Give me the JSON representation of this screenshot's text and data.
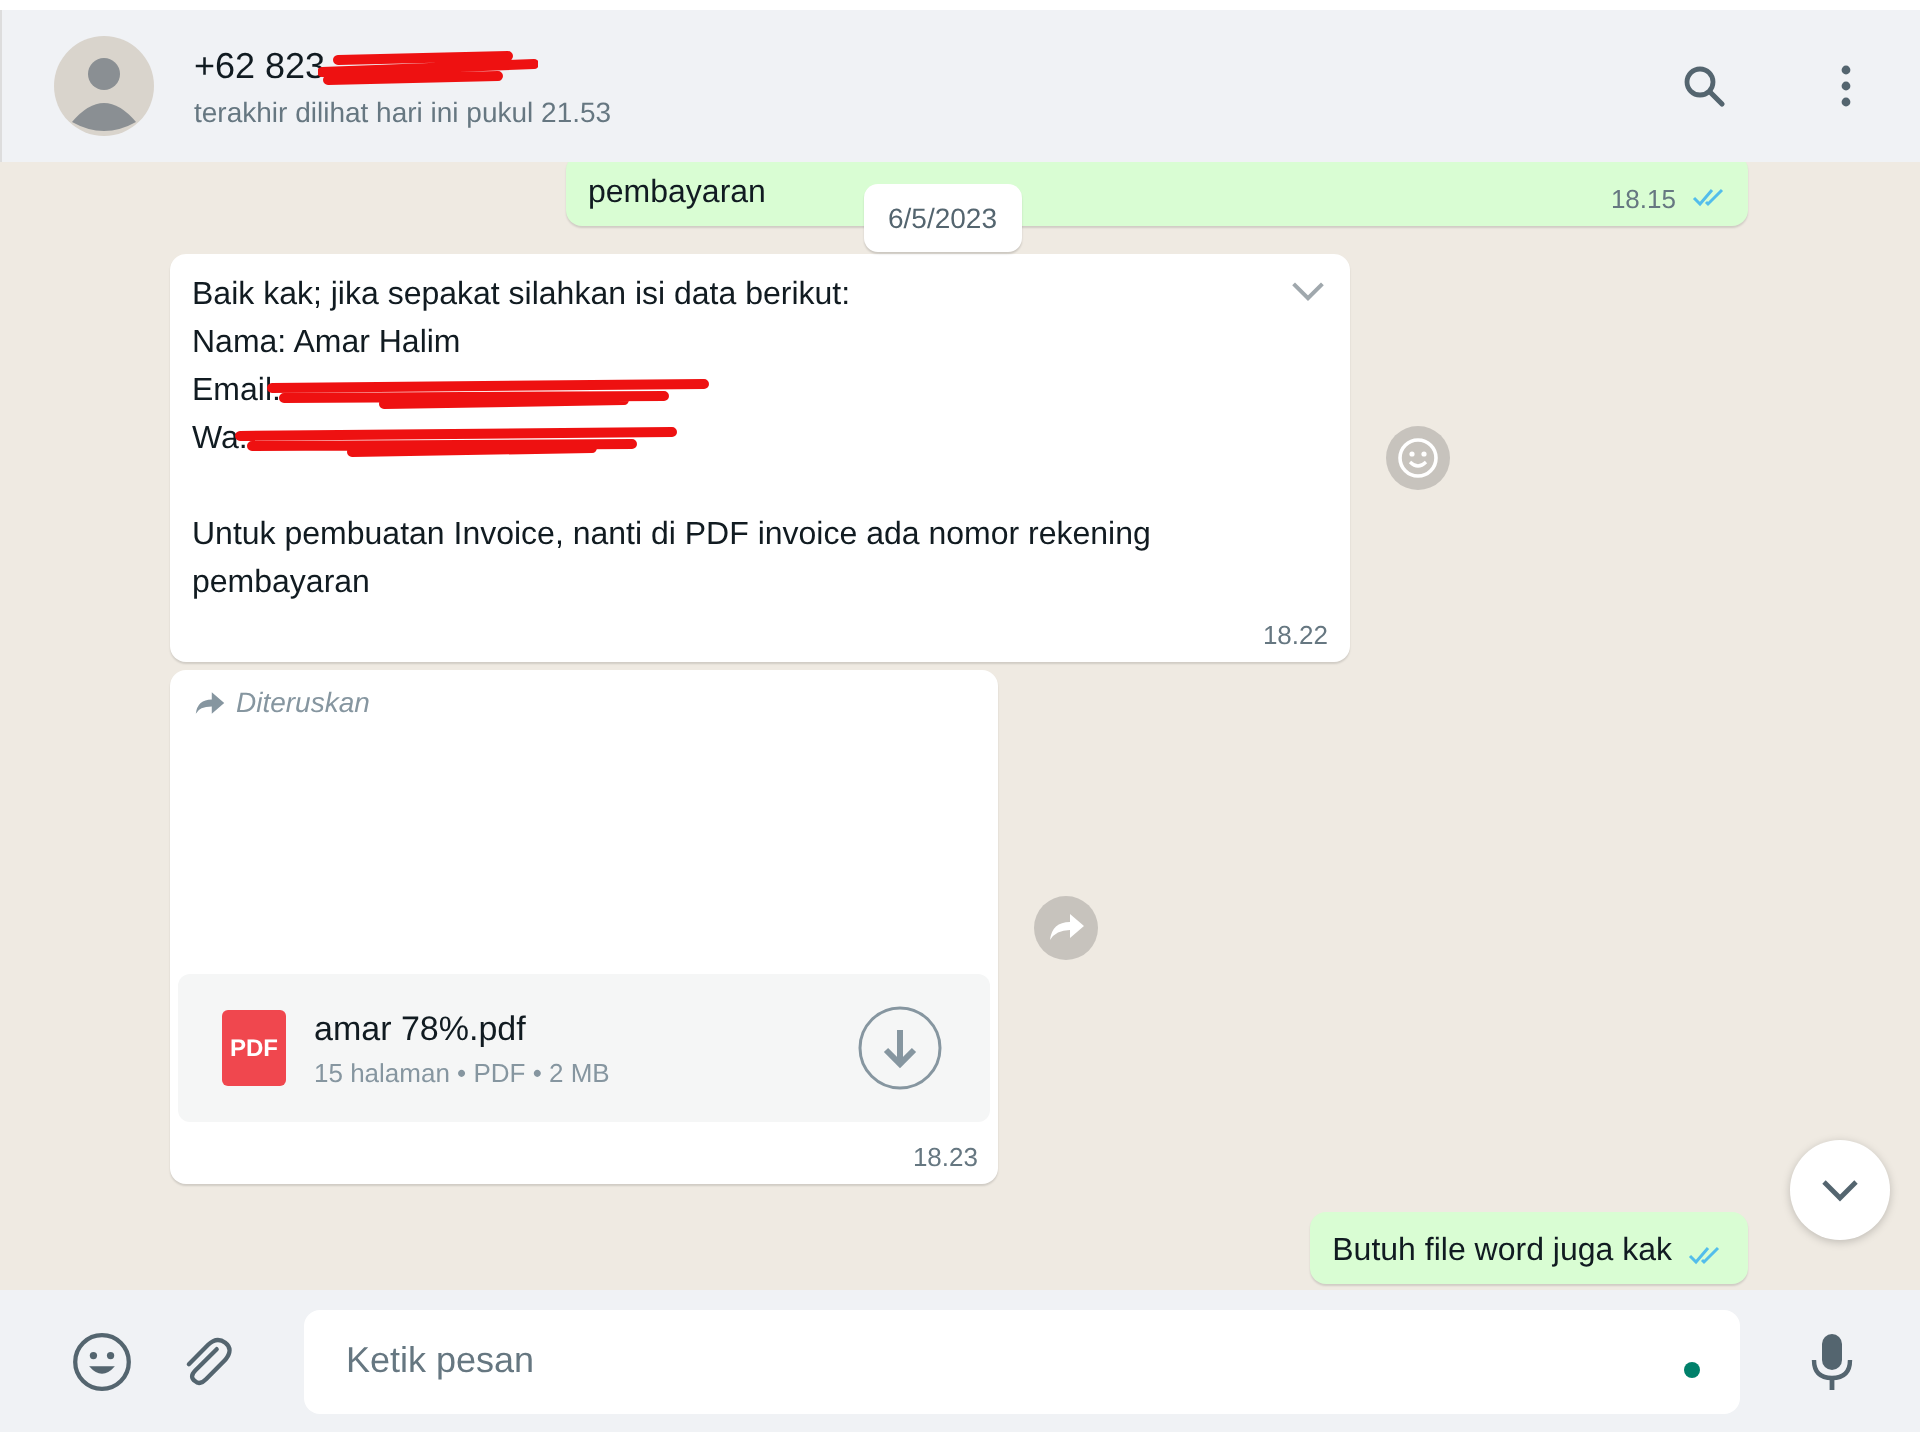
{
  "header": {
    "name": "+62 823",
    "name_redacted": true,
    "status": "terakhir dilihat hari ini pukul 21.53"
  },
  "date_chip": "6/5/2023",
  "messages": [
    {
      "kind": "outgoing",
      "text": "pembayaran",
      "time": "18.15",
      "read": true
    },
    {
      "kind": "text",
      "paragraphs": [
        [
          {
            "text": "Baik kak; jika sepakat silahkan isi data berikut:",
            "redacted": false
          },
          {
            "text": "Nama: Amar Halim",
            "redacted": false
          },
          {
            "text": "Email:",
            "redacted": true
          },
          {
            "text": "Wa:",
            "redacted": true
          }
        ],
        [
          {
            "text": "Untuk pembuatan Invoice, nanti di PDF invoice ada nomor rekening pembayaran",
            "redacted": false
          }
        ]
      ],
      "time": "18.22"
    },
    {
      "kind": "document",
      "forwarded_label": "Diteruskan",
      "file_type": "PDF",
      "file_name": "amar 78%.pdf",
      "file_meta": "15 halaman • PDF • 2 MB",
      "time": "18.23"
    },
    {
      "kind": "outgoing",
      "text": "Butuh file word juga kak",
      "read": true
    }
  ],
  "composer": {
    "placeholder": "Ketik pesan"
  }
}
